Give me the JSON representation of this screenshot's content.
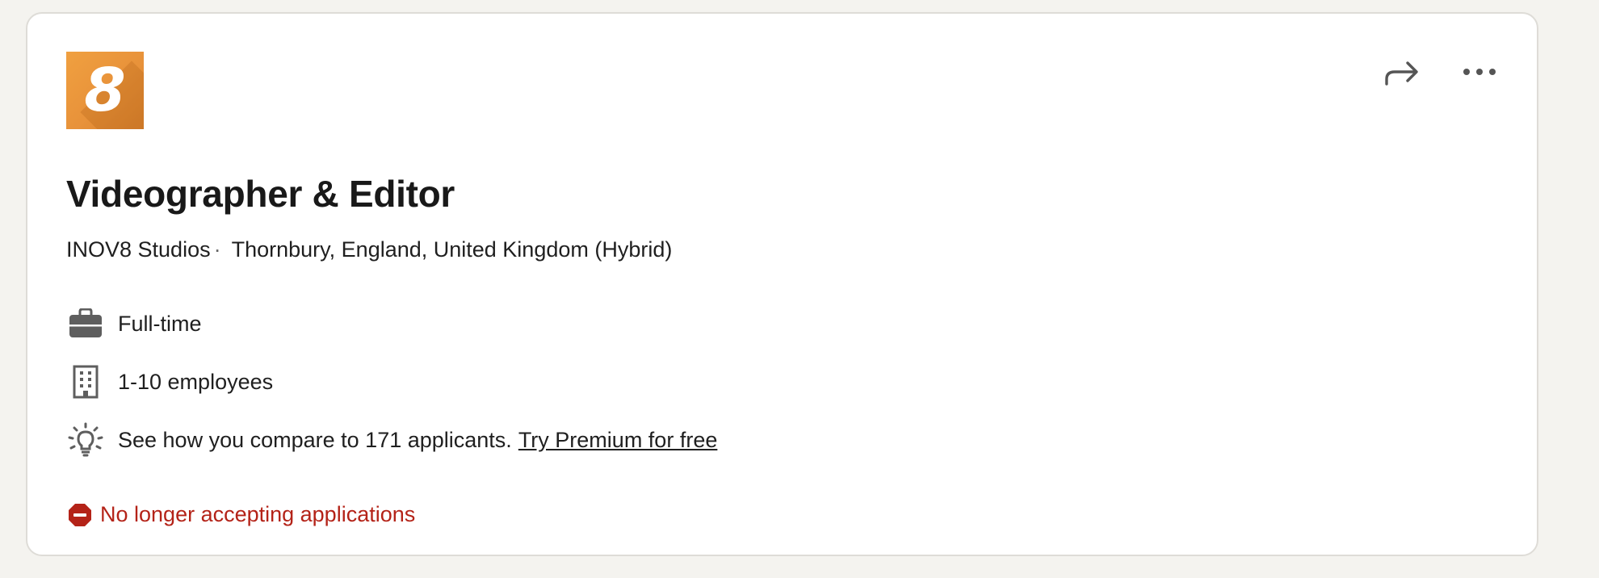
{
  "job": {
    "logo_text": "8",
    "title": "Videographer & Editor",
    "company": "INOV8 Studios",
    "separator": "·",
    "location": "Thornbury, England, United Kingdom (Hybrid)"
  },
  "actions": {
    "share_icon": "share-arrow-icon",
    "more_icon": "more-options-icon"
  },
  "insights": {
    "employment_type": "Full-time",
    "company_size": "1-10 employees",
    "applicants_text": "See how you compare to 171 applicants.",
    "premium_link": "Try Premium for free"
  },
  "status": {
    "text": "No longer accepting applications",
    "color": "#b42318"
  },
  "icons": {
    "employment": "briefcase-icon",
    "company_size": "building-icon",
    "insight": "lightbulb-icon",
    "status": "error-icon"
  }
}
